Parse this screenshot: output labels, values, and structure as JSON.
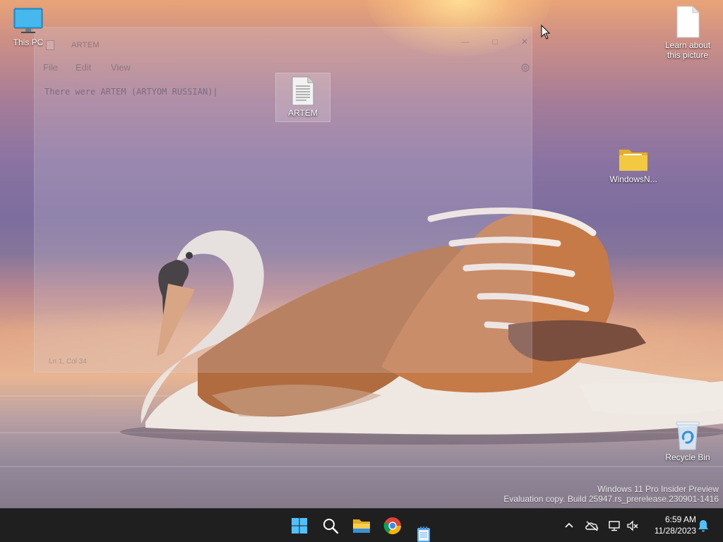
{
  "desktop": {
    "icons": [
      {
        "label": "This PC"
      },
      {
        "label": "ARTEM"
      },
      {
        "label": "Learn about this picture"
      },
      {
        "label": "WindowsN..."
      },
      {
        "label": "Recycle Bin"
      }
    ]
  },
  "notepad": {
    "title": "ARTEM",
    "menu": [
      "File",
      "Edit",
      "View"
    ],
    "content": "There were ARTEM (ARTYOM RUSSIAN)|",
    "status": {
      "position": "Ln 1, Col 34"
    }
  },
  "watermark": {
    "line1": "Windows 11 Pro Insider Preview",
    "line2": "Evaluation copy. Build 25947.rs_prerelease.230901-1416"
  },
  "taskbar": {
    "pinned": [
      "start-icon",
      "search-icon",
      "file-explorer-icon",
      "chrome-icon",
      "notepad-icon"
    ],
    "tray": [
      "chevron-up-icon",
      "onedrive-offline-icon",
      "network-icon",
      "volume-muted-icon",
      "notification-bell-icon"
    ],
    "clock": {
      "time": "6:59 AM",
      "date": "11/28/2023"
    }
  },
  "colors": {
    "taskbar_bg": "#1f1f1f",
    "folder_yellow": "#f4c942",
    "pc_blue": "#2aa0df",
    "recycle_blue": "#2f8fe0"
  }
}
